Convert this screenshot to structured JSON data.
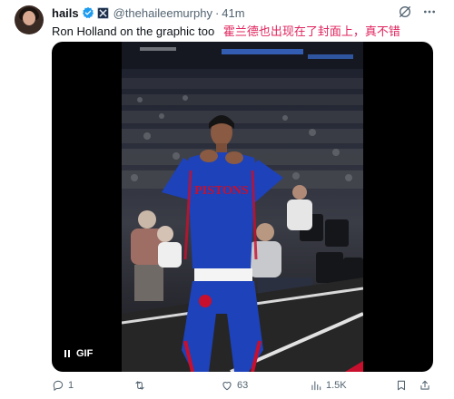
{
  "tweet": {
    "author": {
      "name": "hails",
      "handle": "@thehaileemurphy",
      "separator": "·",
      "time": "41m"
    },
    "text": "Ron Holland on the graphic too",
    "translation": "霍兰德也出现在了封面上，真不错",
    "media": {
      "badge_label": "GIF",
      "jersey_text": "PISTONS"
    },
    "actions": {
      "reply_count": "1",
      "retweet_count": "",
      "like_count": "63",
      "views_count": "1.5K"
    }
  },
  "colors": {
    "verified_blue": "#1d9bf0",
    "translation_text": "#e0245e",
    "secondary_text": "#536471",
    "jersey_blue": "#1d42ba",
    "jersey_red": "#c8102e"
  },
  "icons": [
    "verified-badge-icon",
    "affiliate-badge-icon",
    "grok-icon",
    "more-icon",
    "pause-icon",
    "reply-icon",
    "retweet-icon",
    "like-icon",
    "views-icon",
    "bookmark-icon",
    "share-icon"
  ]
}
